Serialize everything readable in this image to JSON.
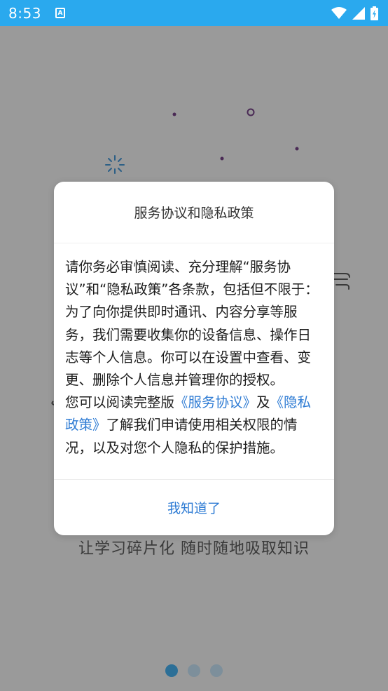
{
  "status_bar": {
    "time": "8:53",
    "notification_icon": "A",
    "bg_color": "#2aa9ee"
  },
  "splash": {
    "slogan": "让学习碎片化 随时随地吸取知识",
    "pager_count": 3,
    "pager_active": 0
  },
  "dialog": {
    "title": "服务协议和隐私政策",
    "body_paragraph_1": "请你务必审慎阅读、充分理解“服务协议”和“隐私政策”各条款，包括但不限于：为了向你提供即时通讯、内容分享等服务，我们需要收集你的设备信息、操作日志等个人信息。你可以在设置中查看、变更、删除个人信息并管理你的授权。",
    "body_paragraph_2_prefix": "您可以阅读完整版",
    "link_service": "《服务协议》",
    "body_and": "及",
    "link_privacy": "《隐私政策》",
    "body_paragraph_2_suffix": "了解我们申请使用相关权限的情况，以及对您个人隐私的保护措施。",
    "confirm_label": "我知道了",
    "link_color": "#2f7cd4"
  }
}
